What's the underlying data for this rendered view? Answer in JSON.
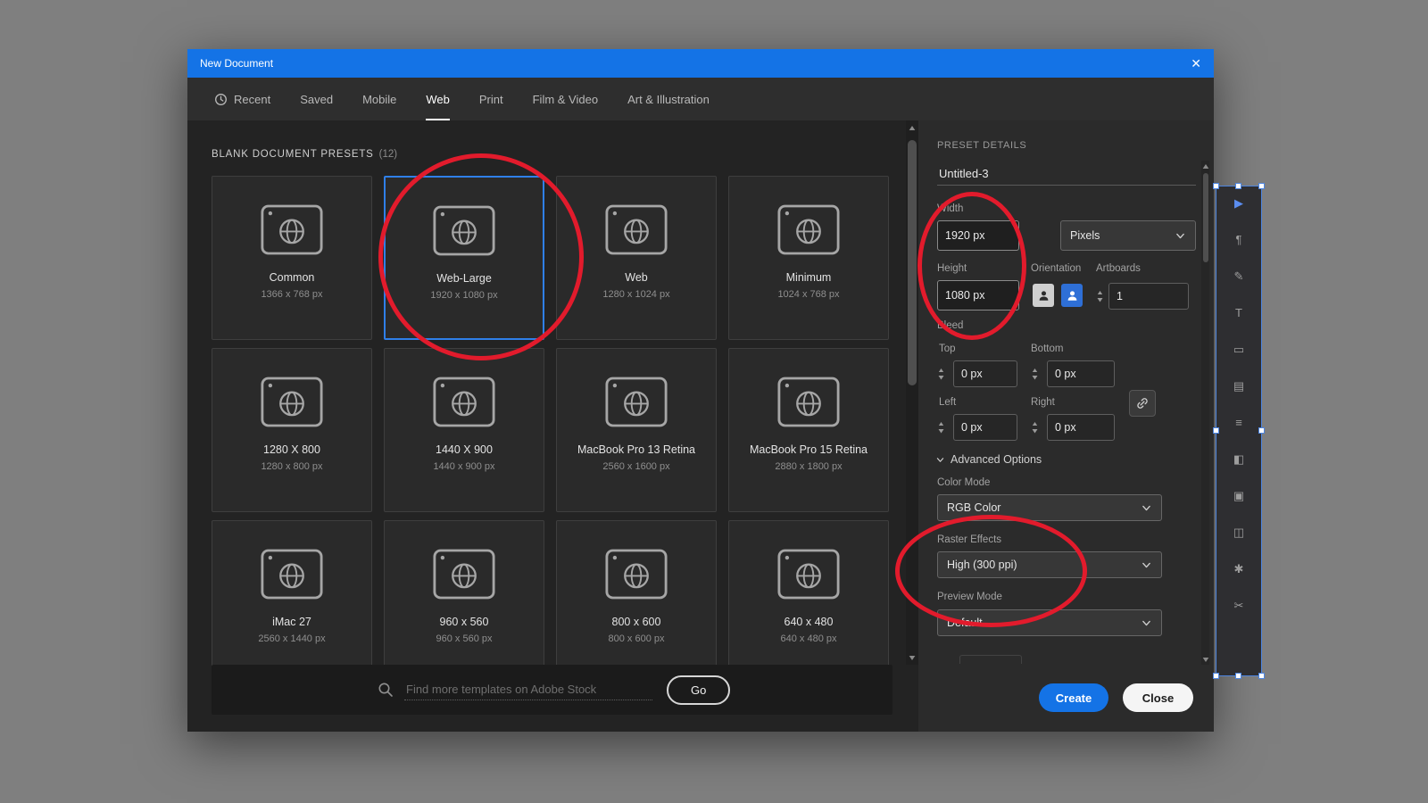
{
  "dialog": {
    "title": "New Document",
    "close_icon": "✕",
    "tabs": [
      {
        "label": "Recent"
      },
      {
        "label": "Saved"
      },
      {
        "label": "Mobile"
      },
      {
        "label": "Web"
      },
      {
        "label": "Print"
      },
      {
        "label": "Film & Video"
      },
      {
        "label": "Art & Illustration"
      }
    ],
    "presets_section": {
      "header": "BLANK DOCUMENT PRESETS",
      "count": "(12)",
      "selected_preset": "Web-Large",
      "presets": [
        {
          "name": "Common",
          "dims": "1366 x 768 px"
        },
        {
          "name": "Web-Large",
          "dims": "1920 x 1080 px"
        },
        {
          "name": "Web",
          "dims": "1280 x 1024 px"
        },
        {
          "name": "Minimum",
          "dims": "1024 x 768 px"
        },
        {
          "name": "1280 X 800",
          "dims": "1280 x 800 px"
        },
        {
          "name": "1440 X 900",
          "dims": "1440 x 900 px"
        },
        {
          "name": "MacBook Pro 13 Retina",
          "dims": "2560 x 1600 px"
        },
        {
          "name": "MacBook Pro 15 Retina",
          "dims": "2880 x 1800 px"
        },
        {
          "name": "iMac 27",
          "dims": "2560 x 1440 px"
        },
        {
          "name": "960 x 560",
          "dims": "960 x 560 px"
        },
        {
          "name": "800 x 600",
          "dims": "800 x 600 px"
        },
        {
          "name": "640 x 480",
          "dims": "640 x 480 px"
        }
      ]
    },
    "search": {
      "placeholder": "Find more templates on Adobe Stock",
      "go_label": "Go"
    },
    "details": {
      "header": "PRESET DETAILS",
      "name_value": "Untitled-3",
      "width": {
        "label": "Width",
        "value": "1920 px"
      },
      "units": {
        "value": "Pixels"
      },
      "height": {
        "label": "Height",
        "value": "1080 px"
      },
      "orientation": {
        "label": "Orientation"
      },
      "artboards": {
        "label": "Artboards",
        "value": "1"
      },
      "bleed": {
        "label": "Bleed",
        "top": {
          "label": "Top",
          "value": "0 px"
        },
        "bottom": {
          "label": "Bottom",
          "value": "0 px"
        },
        "left": {
          "label": "Left",
          "value": "0 px"
        },
        "right": {
          "label": "Right",
          "value": "0 px"
        }
      },
      "advanced_label": "Advanced Options",
      "color_mode": {
        "label": "Color Mode",
        "value": "RGB Color"
      },
      "raster_effects": {
        "label": "Raster Effects",
        "value": "High (300 ppi)"
      },
      "preview_mode": {
        "label": "Preview Mode",
        "value": "Default"
      },
      "create_label": "Create",
      "close_label": "Close"
    }
  },
  "background_app": {
    "toolbar_glyphs": [
      "▶",
      "¶",
      "✎",
      "T",
      "▭",
      "▤",
      "≡",
      "◧",
      "▣",
      "◫",
      "✱",
      "✂"
    ]
  },
  "colors": {
    "titlebar_blue": "#1473e6",
    "accent_blue": "#1473e6",
    "selected_border": "#2f7fe8",
    "annotation_red": "#e21b2c",
    "content_bg": "#232323",
    "panel_bg": "#2b2b2b"
  }
}
